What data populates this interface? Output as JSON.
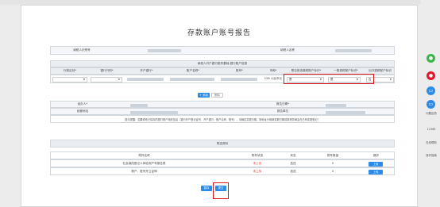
{
  "window": {
    "title": "存款账户账号报告"
  },
  "top": {
    "payer_id_label": "纳税人识别号",
    "payer_name_label": "纳税人名称"
  },
  "accounts": {
    "section_title": "纳税人开户银行账号基础-银行账户信息",
    "headers": [
      "行政区划*",
      "银行行别*",
      "开户银行*",
      "账户名称*",
      "账号*",
      "币种*",
      "是否首选缴税账户标识*",
      "一般退税账户标识*",
      "出口退税账户标识"
    ],
    "row": {
      "currency_value": "156 人民币元",
      "first_tax_value": "是",
      "general_refund_value": "是",
      "export_refund_value": "否"
    },
    "add_label": "+ 添加",
    "delete_label": "删除"
  },
  "info": {
    "agent_label": "经办人*",
    "report_date_label": "报告日期*",
    "address_label": "经营地址",
    "report_unit_label": "报告单位",
    "tip": "提示提醒：如果修改已保存的银行账户相关信息（银行开户登记证号、开户银行、账户名称、账号），请确定变更日期，按地址分相继变更日期前新税务局会在已有变更登记！"
  },
  "attachments": {
    "section_title": "附送资料",
    "headers": [
      "附件名称",
      "附件状态",
      "状态",
      "附件数量",
      "操作"
    ],
    "rows": [
      {
        "name": "社会保险登记人体检测户号报告表",
        "file_status": "未上传",
        "state": "选送",
        "count": "0",
        "action": "上传"
      },
      {
        "name": "账户、账号开立证明",
        "file_status": "未上传",
        "state": "选送",
        "count": "0",
        "action": "上传"
      }
    ]
  },
  "footer": {
    "save_label": "暂存",
    "submit_label": "提交"
  },
  "sidebar": {
    "items": [
      {
        "label": "",
        "icon": "wechat-icon",
        "color": "#3bb54a"
      },
      {
        "label": "",
        "icon": "weibo-icon",
        "color": "#e6162d"
      },
      {
        "label": "",
        "icon": "print-icon",
        "color": "#2b8be6"
      },
      {
        "label": "",
        "icon": "print-icon",
        "color": "#2b8be6"
      },
      {
        "label": "问题反馈",
        "icon": "",
        "color": ""
      },
      {
        "label": "12366",
        "icon": "",
        "color": ""
      },
      {
        "label": "在线帮助",
        "icon": "",
        "color": ""
      },
      {
        "label": "操作指南",
        "icon": "",
        "color": ""
      }
    ]
  },
  "colors": {
    "accent": "#2b8be6",
    "highlight": "#d6171b",
    "warn": "#e0392c"
  }
}
